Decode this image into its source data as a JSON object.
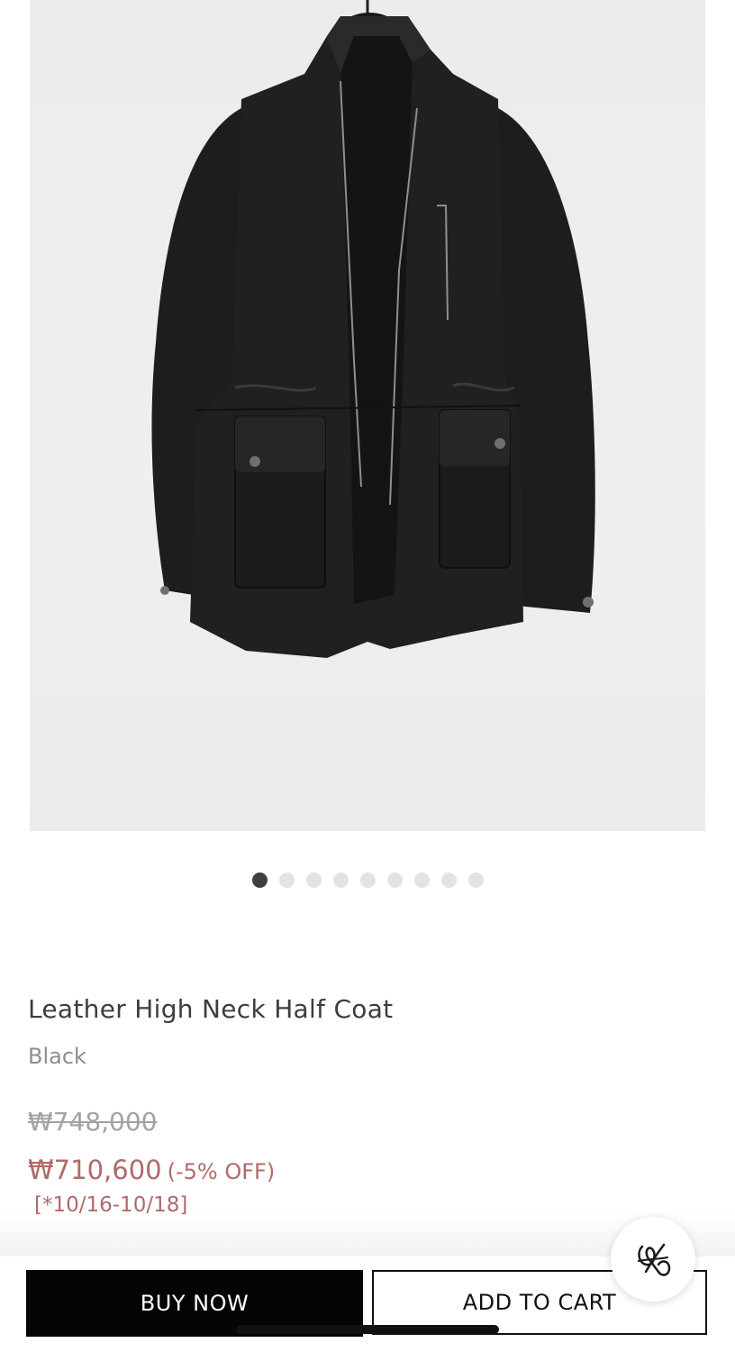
{
  "product": {
    "image_alt": "Black leather high neck half coat on a hanger",
    "title": "Leather High Neck Half Coat",
    "color": "Black",
    "original_price": "₩748,000",
    "sale_price": "₩710,600",
    "discount": "(-5% OFF)",
    "sale_period": "[*10/16-10/18]"
  },
  "carousel": {
    "total": 9,
    "active_index": 0
  },
  "actions": {
    "buy_now_label": "BUY NOW",
    "add_to_cart_label": "ADD TO CART"
  },
  "icons": {
    "floating_button": "brand-monogram-icon"
  },
  "colors": {
    "sale": "#b06a6a",
    "buy_button_bg": "#050505",
    "active_dot": "#3f3f3f",
    "inactive_dot": "#e3e3e3"
  }
}
